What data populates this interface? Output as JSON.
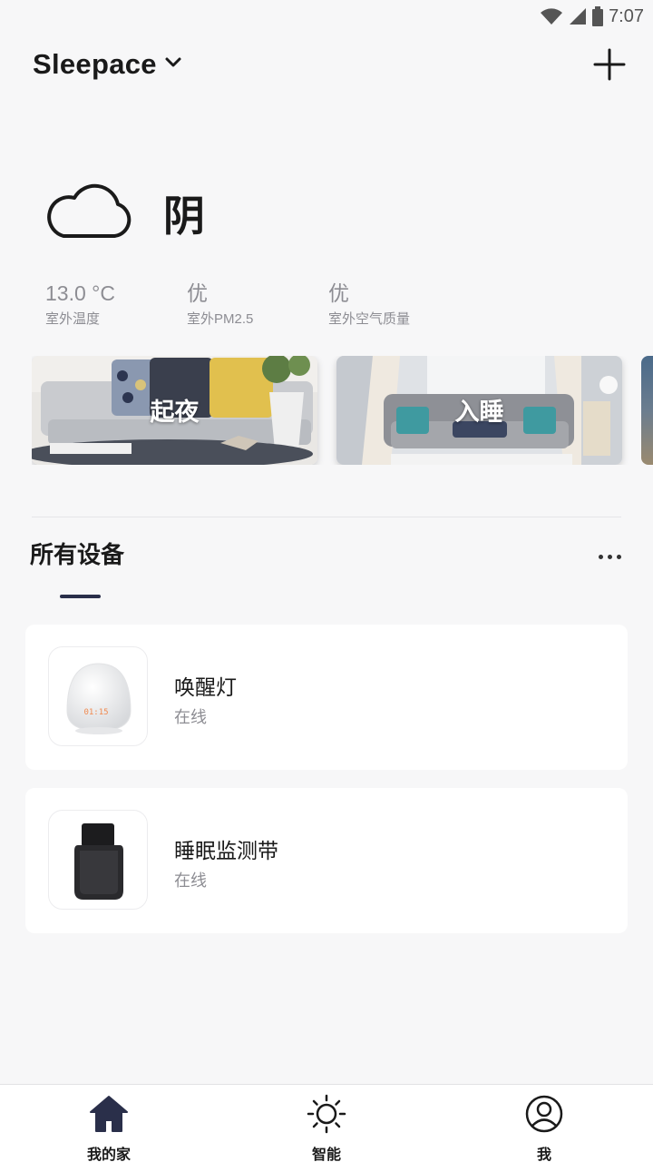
{
  "status_bar": {
    "time": "7:07",
    "icons": [
      "wifi-icon",
      "signal-icon",
      "battery-icon"
    ]
  },
  "header": {
    "home_name": "Sleepace",
    "dropdown_icon": "chevron-down-icon",
    "add_icon": "plus-icon"
  },
  "weather": {
    "icon": "cloud-icon",
    "condition": "阴",
    "stats": [
      {
        "value": "13.0 °C",
        "label": "室外温度"
      },
      {
        "value": "优",
        "label": "室外PM2.5"
      },
      {
        "value": "优",
        "label": "室外空气质量"
      }
    ]
  },
  "scenes": [
    {
      "label": "起夜"
    },
    {
      "label": "入睡"
    }
  ],
  "devices_section": {
    "title": "所有设备",
    "more_icon": "more-dots-icon"
  },
  "devices": [
    {
      "name": "唤醒灯",
      "status": "在线",
      "thumb_text": "01:15"
    },
    {
      "name": "睡眠监测带",
      "status": "在线"
    }
  ],
  "tabbar": [
    {
      "label": "我的家",
      "icon": "home-icon",
      "active": true
    },
    {
      "label": "智能",
      "icon": "sun-icon",
      "active": false
    },
    {
      "label": "我",
      "icon": "user-icon",
      "active": false
    }
  ],
  "colors": {
    "accent": "#2a2f4a",
    "muted_text": "#8d8d93",
    "background": "#f7f7f8"
  }
}
